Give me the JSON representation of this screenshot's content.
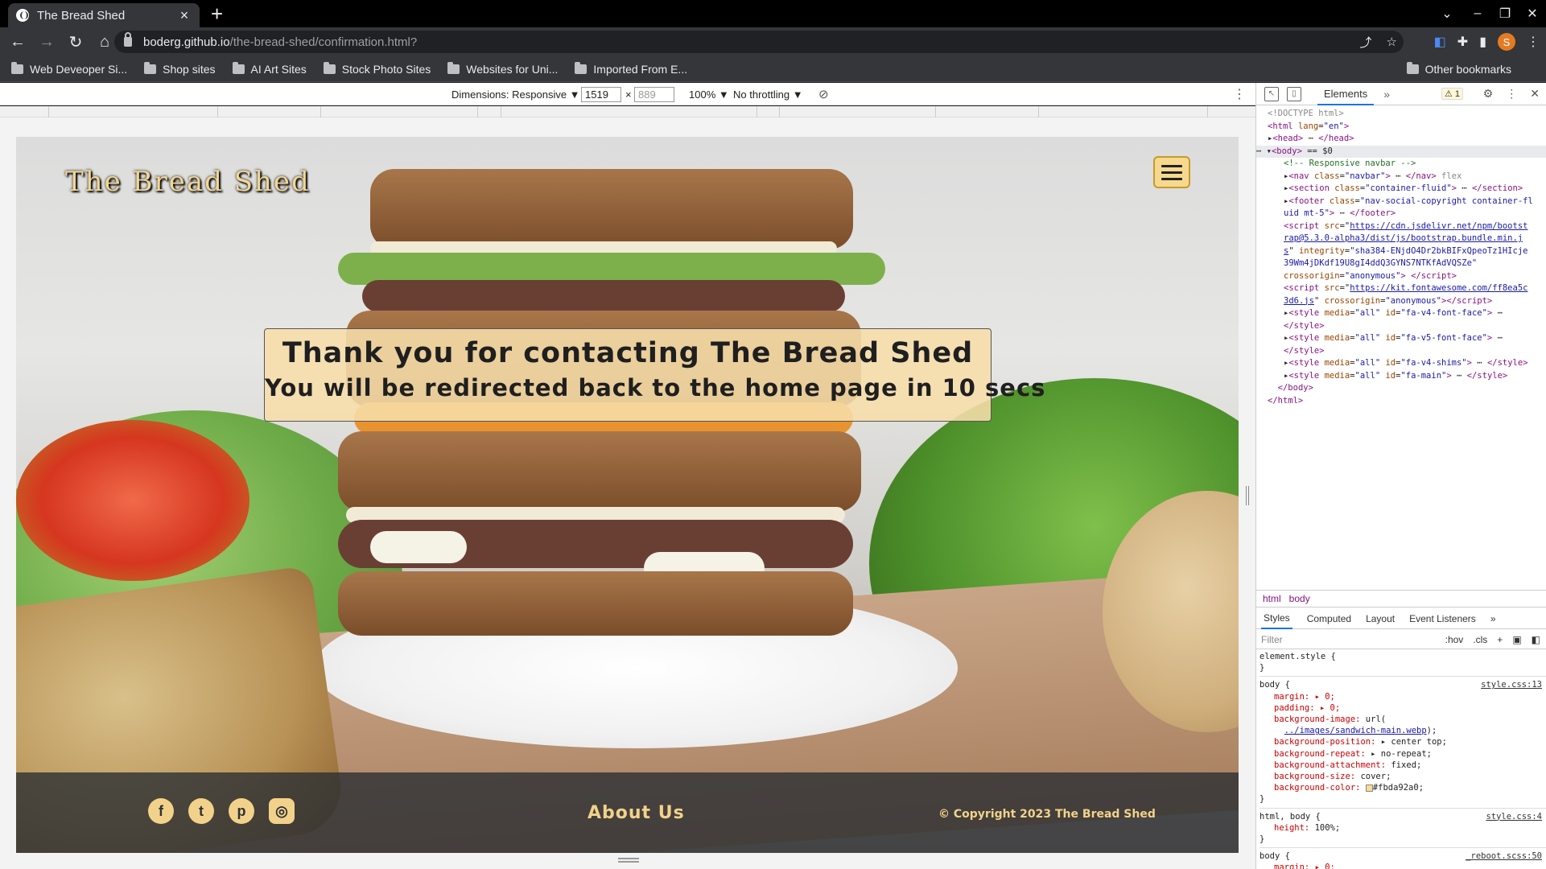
{
  "browser": {
    "tab_title": "The Bread Shed",
    "url_host": "boderg.github.io",
    "url_path": "/the-bread-shed/confirmation.html?",
    "avatar_letter": "S",
    "bookmarks": [
      "Web Deveoper Si...",
      "Shop sites",
      "AI Art Sites",
      "Stock Photo Sites",
      "Websites for Uni...",
      "Imported From E..."
    ],
    "other_bookmarks": "Other bookmarks"
  },
  "device_toolbar": {
    "dimensions_label": "Dimensions: Responsive ▼",
    "width": "1519",
    "height_placeholder": "889",
    "zoom": "100% ▼",
    "throttling": "No throttling ▼"
  },
  "site": {
    "brand": "The Bread Shed",
    "confirm_title": "Thank you for contacting The Bread Shed",
    "confirm_subtitle": "You will be redirected back to the home page in 10 secs",
    "social": [
      {
        "name": "facebook",
        "glyph": "f"
      },
      {
        "name": "twitter",
        "glyph": "t"
      },
      {
        "name": "pinterest",
        "glyph": "p"
      },
      {
        "name": "instagram",
        "glyph": "◎"
      }
    ],
    "about_link": "About Us",
    "copyright": "© Copyright 2023 The Bread Shed",
    "accent_color": "#f2d28a"
  },
  "devtools": {
    "active_tab": "Elements",
    "warning_count": "⚠ 1",
    "breadcrumbs": [
      "html",
      "body"
    ],
    "style_tabs": [
      "Styles",
      "Computed",
      "Layout",
      "Event Listeners"
    ],
    "filter_placeholder": "Filter",
    "filter_tools": [
      ":hov",
      ".cls",
      "+"
    ],
    "dom_lines": [
      {
        "indent": 0,
        "html": "<span class='gr'>&lt;!DOCTYPE html&gt;</span>"
      },
      {
        "indent": 0,
        "html": "<span class='tg'>&lt;html</span> <span class='at'>lang</span>=<span class='av'>\"en\"</span><span class='tg'>&gt;</span>"
      },
      {
        "indent": 0,
        "html": "▸<span class='tg'>&lt;head&gt;</span> ⋯ <span class='tg'>&lt;/head&gt;</span>"
      },
      {
        "indent": 0,
        "html": "⋯ ▾<span class='tg'>&lt;body&gt;</span> == $0",
        "selected": true
      },
      {
        "indent": 1,
        "html": "<span class='cm'>&lt;!-- Responsive navbar --&gt;</span>"
      },
      {
        "indent": 1,
        "html": "▸<span class='tg'>&lt;nav</span> <span class='at'>class</span>=<span class='av'>\"navbar\"</span><span class='tg'>&gt;</span> ⋯ <span class='tg'>&lt;/nav&gt;</span> <span class='gr'>flex</span>"
      },
      {
        "indent": 1,
        "html": "▸<span class='tg'>&lt;section</span> <span class='at'>class</span>=<span class='av'>\"container-fluid\"</span><span class='tg'>&gt;</span> ⋯ <span class='tg'>&lt;/section&gt;</span>"
      },
      {
        "indent": 1,
        "html": "▸<span class='tg'>&lt;footer</span> <span class='at'>class</span>=<span class='av'>\"nav-social-copyright container-fl</span>"
      },
      {
        "indent": 1,
        "html": "<span class='av'>uid mt-5\"</span><span class='tg'>&gt;</span> ⋯ <span class='tg'>&lt;/footer&gt;</span>"
      },
      {
        "indent": 1,
        "html": "<span class='tg'>&lt;script</span> <span class='at'>src</span>=\"<span class='lk'>https://cdn.jsdelivr.net/npm/bootst</span>"
      },
      {
        "indent": 1,
        "html": "<span class='lk'>rap@5.3.0-alpha3/dist/js/bootstrap.bundle.min.j</span>"
      },
      {
        "indent": 1,
        "html": "<span class='lk'>s</span>\" <span class='at'>integrity</span>=<span class='av'>\"sha384-ENjdO4Dr2bkBIFxQpeoTz1HIcje</span>"
      },
      {
        "indent": 1,
        "html": "<span class='av'>39Wm4jDKdf19U8gI4ddQ3GYNS7NTKfAdVQSZe\"</span>"
      },
      {
        "indent": 1,
        "html": "<span class='at'>crossorigin</span>=<span class='av'>\"anonymous\"</span><span class='tg'>&gt; &lt;/script&gt;</span>"
      },
      {
        "indent": 1,
        "html": "<span class='tg'>&lt;script</span> <span class='at'>src</span>=\"<span class='lk'>https://kit.fontawesome.com/ff8ea5c</span>"
      },
      {
        "indent": 1,
        "html": "<span class='lk'>3d6.js</span>\" <span class='at'>crossorigin</span>=<span class='av'>\"anonymous\"</span><span class='tg'>&gt;&lt;/script&gt;</span>"
      },
      {
        "indent": 1,
        "html": "▸<span class='tg'>&lt;style</span> <span class='at'>media</span>=<span class='av'>\"all\"</span> <span class='at'>id</span>=<span class='av'>\"fa-v4-font-face\"</span><span class='tg'>&gt;</span> ⋯"
      },
      {
        "indent": 1,
        "html": "<span class='tg'>&lt;/style&gt;</span>"
      },
      {
        "indent": 1,
        "html": "▸<span class='tg'>&lt;style</span> <span class='at'>media</span>=<span class='av'>\"all\"</span> <span class='at'>id</span>=<span class='av'>\"fa-v5-font-face\"</span><span class='tg'>&gt;</span> ⋯"
      },
      {
        "indent": 1,
        "html": "<span class='tg'>&lt;/style&gt;</span>"
      },
      {
        "indent": 1,
        "html": "▸<span class='tg'>&lt;style</span> <span class='at'>media</span>=<span class='av'>\"all\"</span> <span class='at'>id</span>=<span class='av'>\"fa-v4-shims\"</span><span class='tg'>&gt;</span> ⋯ <span class='tg'>&lt;/style&gt;</span>"
      },
      {
        "indent": 1,
        "html": "▸<span class='tg'>&lt;style</span> <span class='at'>media</span>=<span class='av'>\"all\"</span> <span class='at'>id</span>=<span class='av'>\"fa-main\"</span><span class='tg'>&gt;</span> ⋯ <span class='tg'>&lt;/style&gt;</span>"
      },
      {
        "indent": 0,
        "html": "&nbsp;&nbsp;<span class='tg'>&lt;/body&gt;</span>"
      },
      {
        "indent": 0,
        "html": "<span class='tg'>&lt;/html&gt;</span>"
      }
    ],
    "style_lines": [
      {
        "cls": "",
        "html": "element.style {"
      },
      {
        "cls": "",
        "html": "}"
      },
      {
        "cls": "sep",
        "html": ""
      },
      {
        "cls": "",
        "html": "body { <span class='src'>style.css:13</span>"
      },
      {
        "cls": "prop",
        "html": "margin: ▸ 0;"
      },
      {
        "cls": "prop",
        "html": "padding: ▸ 0;"
      },
      {
        "cls": "prop",
        "html": "background-image: <span style='color:#222'>url(</span>"
      },
      {
        "cls": "prop",
        "html": "&nbsp;&nbsp;<span class='lk'>../images/sandwich-main.webp</span><span style='color:#222'>);</span>"
      },
      {
        "cls": "prop",
        "html": "background-position: <span style='color:#222'>▸ center top;</span>"
      },
      {
        "cls": "prop",
        "html": "background-repeat: <span style='color:#222'>▸ no-repeat;</span>"
      },
      {
        "cls": "prop",
        "html": "background-attachment: <span style='color:#222'>fixed;</span>"
      },
      {
        "cls": "prop",
        "html": "background-size: <span style='color:#222'>cover;</span>"
      },
      {
        "cls": "prop",
        "html": "background-color: <span class='swatch'></span><span style='color:#222'>#fbda92a0;</span>"
      },
      {
        "cls": "",
        "html": "}"
      },
      {
        "cls": "sep",
        "html": ""
      },
      {
        "cls": "",
        "html": "html, body { <span class='src'>style.css:4</span>"
      },
      {
        "cls": "prop",
        "html": "height: <span style='color:#222'>100%;</span>"
      },
      {
        "cls": "",
        "html": "}"
      },
      {
        "cls": "sep",
        "html": ""
      },
      {
        "cls": "",
        "html": "body { <span class='src'>_reboot.scss:50</span>"
      },
      {
        "cls": "prop",
        "html": "margin: ▸ 0;"
      }
    ]
  }
}
